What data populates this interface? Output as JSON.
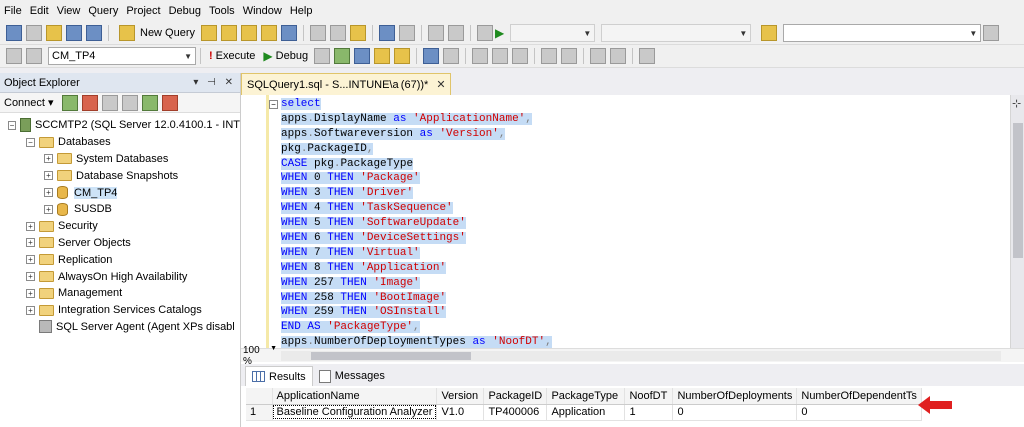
{
  "menu": [
    "File",
    "Edit",
    "View",
    "Query",
    "Project",
    "Debug",
    "Tools",
    "Window",
    "Help"
  ],
  "toolbar": {
    "new_query": "New Query",
    "database": "CM_TP4",
    "execute": "Execute",
    "debug": "Debug"
  },
  "object_explorer": {
    "title": "Object Explorer",
    "pin_glyphs": "▾ ⊣ ✕",
    "connect": "Connect ▾",
    "server": "SCCMTP2 (SQL Server 12.0.4100.1 - INT",
    "databases": "Databases",
    "system_databases": "System Databases",
    "database_snapshots": "Database Snapshots",
    "db_cm": "CM_TP4",
    "db_sus": "SUSDB",
    "security": "Security",
    "server_objects": "Server Objects",
    "replication": "Replication",
    "alwayson": "AlwaysOn High Availability",
    "management": "Management",
    "integration": "Integration Services Catalogs",
    "agent": "SQL Server Agent (Agent XPs disabl"
  },
  "editor": {
    "tab_title": "SQLQuery1.sql - S...INTUNE\\a (67))*",
    "tab_close": "✕",
    "zoom": "100 %",
    "code_lines": [
      [
        {
          "t": "select",
          "c": "kw"
        }
      ],
      [
        {
          "t": "apps",
          "c": "plain"
        },
        {
          "t": ".",
          "c": "gray"
        },
        {
          "t": "DisplayName ",
          "c": "plain"
        },
        {
          "t": "as ",
          "c": "kw"
        },
        {
          "t": "'ApplicationName'",
          "c": "str"
        },
        {
          "t": ",",
          "c": "gray"
        }
      ],
      [
        {
          "t": "apps",
          "c": "plain"
        },
        {
          "t": ".",
          "c": "gray"
        },
        {
          "t": "Softwareversion ",
          "c": "plain"
        },
        {
          "t": "as ",
          "c": "kw"
        },
        {
          "t": "'Version'",
          "c": "str"
        },
        {
          "t": ",",
          "c": "gray"
        }
      ],
      [
        {
          "t": "pkg",
          "c": "plain"
        },
        {
          "t": ".",
          "c": "gray"
        },
        {
          "t": "PackageID",
          "c": "plain"
        },
        {
          "t": ",",
          "c": "gray"
        }
      ],
      [
        {
          "t": "CASE ",
          "c": "kw"
        },
        {
          "t": "pkg",
          "c": "plain"
        },
        {
          "t": ".",
          "c": "gray"
        },
        {
          "t": "PackageType",
          "c": "plain"
        }
      ],
      [
        {
          "t": "WHEN ",
          "c": "kw"
        },
        {
          "t": "0 ",
          "c": "plain"
        },
        {
          "t": "THEN ",
          "c": "kw"
        },
        {
          "t": "'Package'",
          "c": "str"
        }
      ],
      [
        {
          "t": "WHEN ",
          "c": "kw"
        },
        {
          "t": "3 ",
          "c": "plain"
        },
        {
          "t": "THEN ",
          "c": "kw"
        },
        {
          "t": "'Driver'",
          "c": "str"
        }
      ],
      [
        {
          "t": "WHEN ",
          "c": "kw"
        },
        {
          "t": "4 ",
          "c": "plain"
        },
        {
          "t": "THEN ",
          "c": "kw"
        },
        {
          "t": "'TaskSequence'",
          "c": "str"
        }
      ],
      [
        {
          "t": "WHEN ",
          "c": "kw"
        },
        {
          "t": "5 ",
          "c": "plain"
        },
        {
          "t": "THEN ",
          "c": "kw"
        },
        {
          "t": "'SoftwareUpdate'",
          "c": "str"
        }
      ],
      [
        {
          "t": "WHEN ",
          "c": "kw"
        },
        {
          "t": "6 ",
          "c": "plain"
        },
        {
          "t": "THEN ",
          "c": "kw"
        },
        {
          "t": "'DeviceSettings'",
          "c": "str"
        }
      ],
      [
        {
          "t": "WHEN ",
          "c": "kw"
        },
        {
          "t": "7 ",
          "c": "plain"
        },
        {
          "t": "THEN ",
          "c": "kw"
        },
        {
          "t": "'Virtual'",
          "c": "str"
        }
      ],
      [
        {
          "t": "WHEN ",
          "c": "kw"
        },
        {
          "t": "8 ",
          "c": "plain"
        },
        {
          "t": "THEN ",
          "c": "kw"
        },
        {
          "t": "'Application'",
          "c": "str"
        }
      ],
      [
        {
          "t": "WHEN ",
          "c": "kw"
        },
        {
          "t": "257 ",
          "c": "plain"
        },
        {
          "t": "THEN ",
          "c": "kw"
        },
        {
          "t": "'Image'",
          "c": "str"
        }
      ],
      [
        {
          "t": "WHEN ",
          "c": "kw"
        },
        {
          "t": "258 ",
          "c": "plain"
        },
        {
          "t": "THEN ",
          "c": "kw"
        },
        {
          "t": "'BootImage'",
          "c": "str"
        }
      ],
      [
        {
          "t": "WHEN ",
          "c": "kw"
        },
        {
          "t": "259 ",
          "c": "plain"
        },
        {
          "t": "THEN ",
          "c": "kw"
        },
        {
          "t": "'OSInstall'",
          "c": "str"
        }
      ],
      [
        {
          "t": "END ",
          "c": "kw"
        },
        {
          "t": "AS ",
          "c": "kw"
        },
        {
          "t": "'PackageType'",
          "c": "str"
        },
        {
          "t": ",",
          "c": "gray"
        }
      ],
      [
        {
          "t": "apps",
          "c": "plain"
        },
        {
          "t": ".",
          "c": "gray"
        },
        {
          "t": "NumberOfDeploymentTypes ",
          "c": "plain"
        },
        {
          "t": "as ",
          "c": "kw"
        },
        {
          "t": "'NoofDT'",
          "c": "str"
        },
        {
          "t": ",",
          "c": "gray"
        }
      ]
    ]
  },
  "results": {
    "tab_results": "Results",
    "tab_messages": "Messages",
    "columns": [
      "ApplicationName",
      "Version",
      "PackageID",
      "PackageType",
      "NoofDT",
      "NumberOfDeployments",
      "NumberOfDependentTs"
    ],
    "rows": [
      {
        "num": "1",
        "cells": [
          "Baseline Configuration Analyzer",
          "V1.0",
          "TP400006",
          "Application",
          "1",
          "0",
          "0"
        ]
      }
    ]
  },
  "colors": {
    "keyword": "#0000ff",
    "string": "#d10000",
    "selection": "#c5dcf5",
    "arrow": "#e02020"
  }
}
